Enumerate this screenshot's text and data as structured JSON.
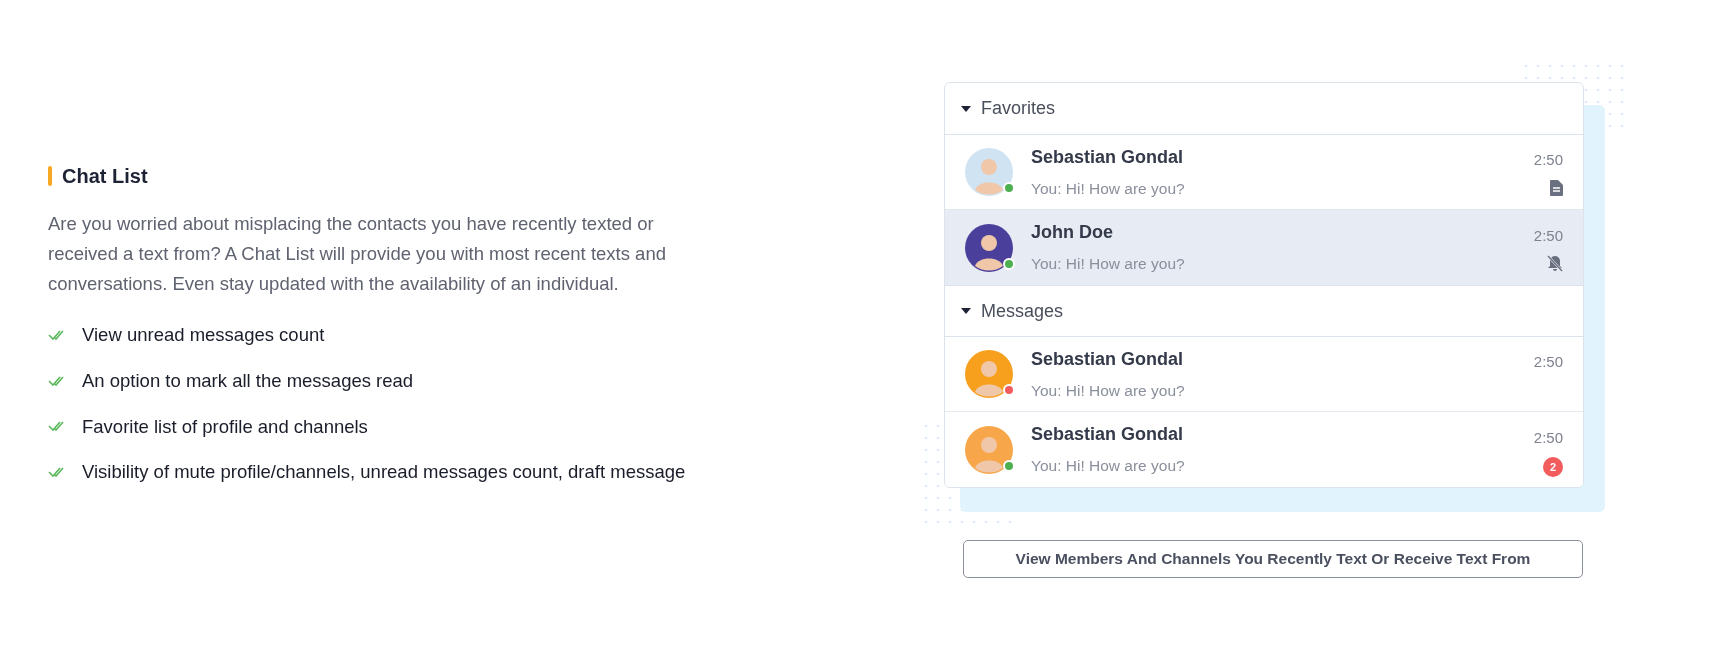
{
  "feature": {
    "title": "Chat List",
    "description": "Are you worried about misplacing the contacts you have recently texted or received a text from? A Chat List will provide you with most recent texts and conversations. Even stay updated with the availability of an individual.",
    "points": [
      "View unread messages count",
      "An option to mark all the messages read",
      "Favorite list of profile and channels",
      "Visibility of mute profile/channels, unread messages count, draft message"
    ]
  },
  "chat_list": {
    "sections": [
      {
        "title": "Favorites",
        "expanded": true,
        "chats": [
          {
            "name": "Sebastian Gondal",
            "preview": "You: Hi! How are you?",
            "time": "2:50",
            "color": "#4caf50",
            "selected": false,
            "indicator": {
              "kind": "draft"
            }
          },
          {
            "name": "John Doe",
            "preview": "You: Hi! How are you?",
            "time": "2:50",
            "color": "#4caf50",
            "selected": true,
            "indicator": {
              "kind": "muted"
            }
          }
        ]
      },
      {
        "title": "Messages",
        "expanded": true,
        "chats": [
          {
            "name": "Sebastian Gondal",
            "preview": "You: Hi! How are you?",
            "time": "2:50",
            "color": "#f25c5c",
            "selected": false
          },
          {
            "name": "Sebastian Gondal",
            "preview": "You: Hi! How are you?",
            "time": "2:50",
            "color": "#4caf50",
            "selected": false,
            "indicator": {
              "kind": "unread",
              "count": "2"
            }
          }
        ]
      }
    ]
  },
  "caption_button": "View Members And Channels You Recently Text Or Receive Text From"
}
